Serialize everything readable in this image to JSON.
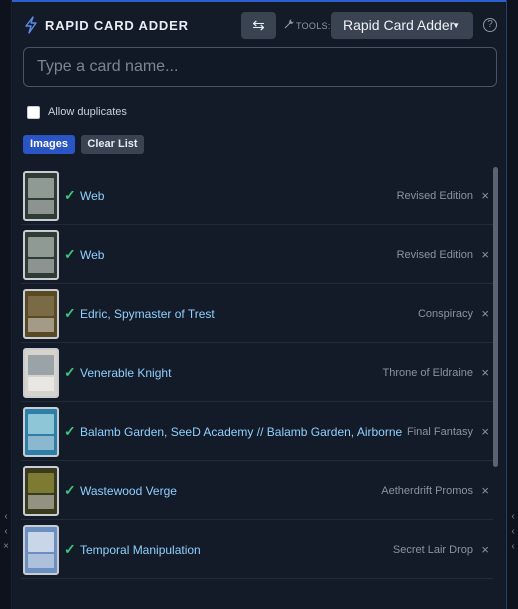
{
  "header": {
    "title": "RAPID CARD ADDER",
    "swap_icon": "⇆",
    "tools_label": "TOOLS:",
    "tool_selected": "Rapid Card Adder",
    "help_icon": "?"
  },
  "search": {
    "placeholder": "Type a card name..."
  },
  "options": {
    "allow_duplicates_label": "Allow duplicates",
    "allow_duplicates_checked": false
  },
  "actions": {
    "images_label": "Images",
    "clear_label": "Clear List"
  },
  "cards": [
    {
      "name": "Web",
      "set": "Revised Edition"
    },
    {
      "name": "Web",
      "set": "Revised Edition"
    },
    {
      "name": "Edric, Spymaster of Trest",
      "set": "Conspiracy"
    },
    {
      "name": "Venerable Knight",
      "set": "Throne of Eldraine"
    },
    {
      "name": "Balamb Garden, SeeD Academy // Balamb Garden, Airborne",
      "set": "Final Fantasy"
    },
    {
      "name": "Wastewood Verge",
      "set": "Aetherdrift Promos"
    },
    {
      "name": "Temporal Manipulation",
      "set": "Secret Lair Drop"
    }
  ],
  "row_check_icon": "✓",
  "row_remove_icon": "×",
  "colors": {
    "accent": "#2a55c4",
    "card_name": "#8fd0ff",
    "check": "#3fc57a",
    "panel_bg": "#141b28"
  }
}
